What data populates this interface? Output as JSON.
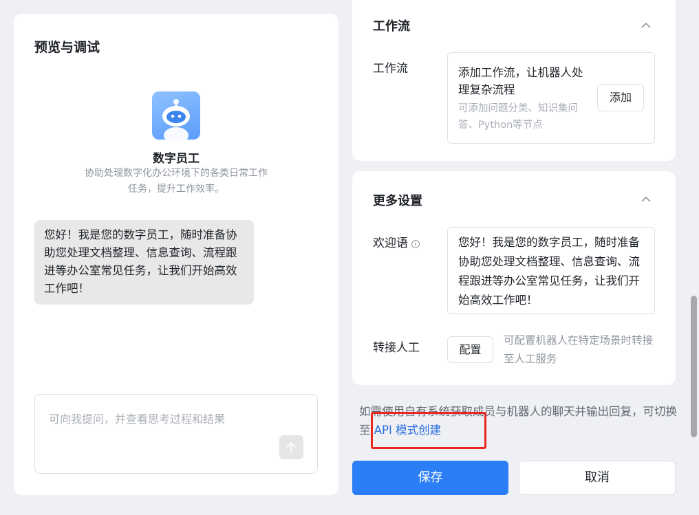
{
  "preview": {
    "title": "预览与调试",
    "bot_name": "数字员工",
    "bot_description": "协助处理数字化办公环境下的各类日常工作任务，提升工作效率。",
    "greeting_message": "您好！我是您的数字员工，随时准备协助您处理文档整理、信息查询、流程跟进等办公室常见任务，让我们开始高效工作吧！",
    "input_placeholder": "可向我提问，并查看思考过程和结果"
  },
  "workflow": {
    "section_title": "工作流",
    "field_label": "工作流",
    "main_text": "添加工作流，让机器人处理复杂流程",
    "sub_text": "可添加问题分类、知识集问答、Python等节点",
    "add_label": "添加"
  },
  "more_settings": {
    "section_title": "更多设置",
    "welcome_label": "欢迎语",
    "welcome_text": "您好！我是您的数字员工，随时准备协助您处理文档整理、信息查询、流程跟进等办公室常见任务，让我们开始高效工作吧！",
    "transfer_label": "转接人工",
    "config_label": "配置",
    "transfer_desc": "可配置机器人在特定场景时转接至人工服务"
  },
  "api_note": {
    "text": "如需使用自有系统获取成员与机器人的聊天并输出回复，可切换至",
    "link": "API 模式创建"
  },
  "actions": {
    "save": "保存",
    "cancel": "取消"
  },
  "colors": {
    "primary": "#2b7ef5",
    "link": "#2b6fe0",
    "highlight": "#e8281f"
  }
}
